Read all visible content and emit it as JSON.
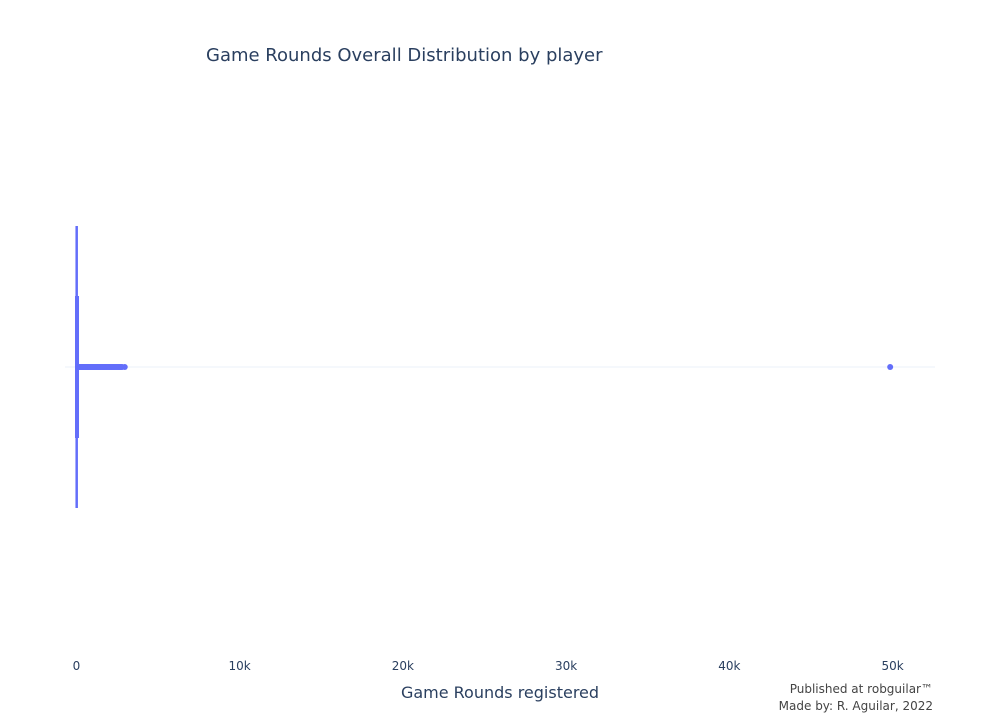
{
  "chart_data": {
    "type": "box",
    "orientation": "horizontal",
    "title": "Game Rounds Overall Distribution by player",
    "xlabel": "Game Rounds registered",
    "ylabel": "",
    "xlim": [
      -700,
      52600
    ],
    "xticks": [
      0,
      10000,
      20000,
      30000,
      40000,
      50000
    ],
    "xtick_labels": [
      "0",
      "10k",
      "20k",
      "30k",
      "40k",
      "50k"
    ],
    "grid": false,
    "series": [
      {
        "color": "#636efa",
        "box": {
          "min": 0,
          "q1": 5,
          "median": 16,
          "q3": 51,
          "upper_fence": 120
        },
        "outlier_cluster_range": [
          120,
          2800
        ],
        "outliers": [
          2961,
          49854
        ]
      }
    ]
  },
  "footer": {
    "line1": "Published at robguilar™",
    "line2": "Made by:  R. Aguilar, 2022"
  },
  "colors": {
    "marker": "#636efa",
    "text": "#2a3f5f",
    "zeroline": "#ebf0f8"
  }
}
